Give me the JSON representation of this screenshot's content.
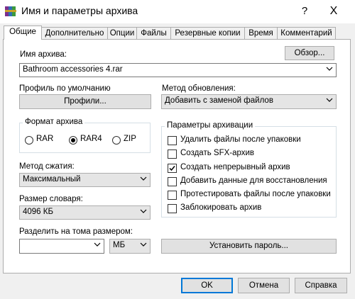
{
  "window": {
    "title": "Имя и параметры архива",
    "help_glyph": "?",
    "close_glyph": "X"
  },
  "tabs": [
    {
      "label": "Общие",
      "active": true
    },
    {
      "label": "Дополнительно"
    },
    {
      "label": "Опции"
    },
    {
      "label": "Файлы"
    },
    {
      "label": "Резервные копии"
    },
    {
      "label": "Время"
    },
    {
      "label": "Комментарий"
    }
  ],
  "archive_name": {
    "label": "Имя архива:",
    "browse_button": "Обзор...",
    "value": "Bathroom accessories 4.rar"
  },
  "profile": {
    "label": "Профиль по умолчанию",
    "button": "Профили..."
  },
  "update_method": {
    "label": "Метод обновления:",
    "value": "Добавить с заменой файлов"
  },
  "archive_format": {
    "title": "Формат архива",
    "options": [
      {
        "label": "RAR"
      },
      {
        "label": "RAR4"
      },
      {
        "label": "ZIP"
      }
    ],
    "selected": "RAR4"
  },
  "compression": {
    "label": "Метод сжатия:",
    "value": "Максимальный"
  },
  "dictionary": {
    "label": "Размер словаря:",
    "value": "4096 КБ"
  },
  "split": {
    "label": "Разделить на тома размером:",
    "value": "",
    "unit": "МБ"
  },
  "archive_options": {
    "title": "Параметры архивации",
    "items": [
      {
        "label": "Удалить файлы после упаковки",
        "checked": false
      },
      {
        "label": "Создать SFX-архив",
        "checked": false
      },
      {
        "label": "Создать непрерывный архив",
        "checked": true
      },
      {
        "label": "Добавить данные для восстановления",
        "checked": false
      },
      {
        "label": "Протестировать файлы после упаковки",
        "checked": false
      },
      {
        "label": "Заблокировать архив",
        "checked": false
      }
    ]
  },
  "password_button": "Установить пароль...",
  "footer": {
    "ok": "OK",
    "cancel": "Отмена",
    "help": "Справка"
  },
  "colors": {
    "accent": "#0078d7",
    "panel": "#ffffff",
    "dialog": "#f0f0f0"
  },
  "icons": {
    "app": "winrar-books-icon",
    "chevron": "chevron-down-icon",
    "check": "check-icon"
  }
}
